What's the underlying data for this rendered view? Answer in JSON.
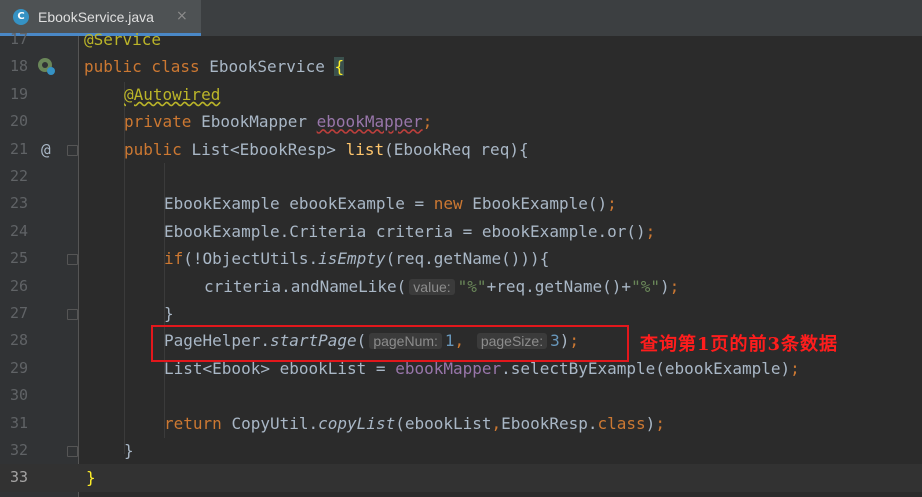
{
  "tab": {
    "icon_letter": "C",
    "title": "EbookService.java",
    "close": "×"
  },
  "lines": [
    {
      "n": "17",
      "text": "@Service"
    },
    {
      "n": "18",
      "text": "public class EbookService {"
    },
    {
      "n": "19",
      "text": "@Autowired"
    },
    {
      "n": "20",
      "text": "private EbookMapper ebookMapper;"
    },
    {
      "n": "21",
      "text": "public List<EbookResp> list(EbookReq req){"
    },
    {
      "n": "22",
      "text": ""
    },
    {
      "n": "23",
      "text": "EbookExample ebookExample = new EbookExample();"
    },
    {
      "n": "24",
      "text": "EbookExample.Criteria criteria = ebookExample.or();"
    },
    {
      "n": "25",
      "text": "if(!ObjectUtils.isEmpty(req.getName())){"
    },
    {
      "n": "26",
      "text": "criteria.andNameLike( value: \"%\"+req.getName()+\"%\");"
    },
    {
      "n": "27",
      "text": "}"
    },
    {
      "n": "28",
      "text": "PageHelper.startPage( pageNum: 1, pageSize: 3);"
    },
    {
      "n": "29",
      "text": "List<Ebook> ebookList = ebookMapper.selectByExample(ebookExample);"
    },
    {
      "n": "30",
      "text": ""
    },
    {
      "n": "31",
      "text": "return CopyUtil.copyList(ebookList,EbookResp.class);"
    },
    {
      "n": "32",
      "text": "}"
    },
    {
      "n": "33",
      "text": "}"
    }
  ],
  "hints": {
    "value": "value:",
    "pageNum": "pageNum:",
    "pageSize": "pageSize:"
  },
  "annotation_note": "查询第1页的前3条数据",
  "gutter_icons": {
    "line18": "spring-bean-icon",
    "line21": "override-at-icon"
  },
  "colors": {
    "keyword": "#cc7832",
    "annotation": "#bbb529",
    "field": "#9876aa",
    "method": "#ffc66d",
    "string": "#6a8759",
    "number": "#6897bb",
    "highlight_box": "#e2171c"
  }
}
